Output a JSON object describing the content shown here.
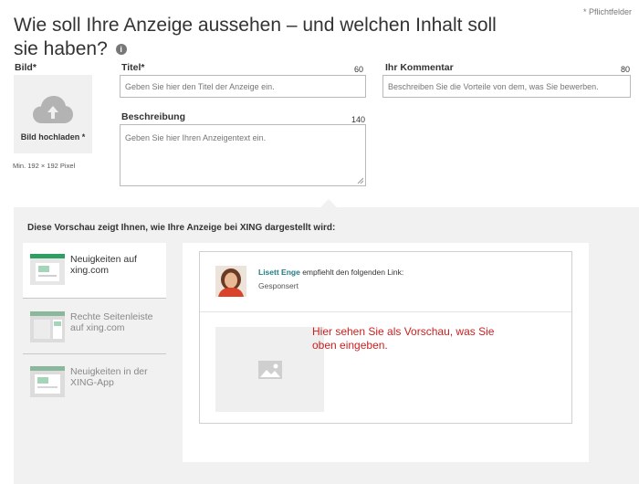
{
  "header": {
    "title": "Wie soll Ihre Anzeige aussehen – und welchen Inhalt soll sie haben?",
    "info_icon": "i",
    "required_note": "* Pflichtfelder"
  },
  "form": {
    "image": {
      "label": "Bild*",
      "upload_label": "Bild hochladen *",
      "hint": "Min. 192 × 192 Pixel",
      "icon": "cloud-upload-icon"
    },
    "title": {
      "label": "Titel*",
      "counter": "60",
      "placeholder": "Geben Sie hier den Titel der Anzeige ein."
    },
    "comment": {
      "label": "Ihr Kommentar",
      "counter": "80",
      "placeholder": "Beschreiben Sie die Vorteile von dem, was Sie bewerben."
    },
    "description": {
      "label": "Beschreibung",
      "counter": "140",
      "placeholder": "Geben Sie hier Ihren Anzeigentext ein."
    }
  },
  "preview": {
    "heading": "Diese Vorschau zeigt Ihnen, wie Ihre Anzeige bei XING dargestellt wird:",
    "nav": [
      {
        "label": "Neuigkeiten auf xing.com",
        "active": true
      },
      {
        "label": "Rechte Seitenleiste auf xing.com",
        "active": false
      },
      {
        "label": "Neuigkeiten in der XING-App",
        "active": false
      }
    ],
    "card": {
      "author": "Lisett Enge",
      "action": "empfiehlt den folgenden Link:",
      "sponsored": "Gesponsert",
      "note": "Hier sehen Sie als Vorschau, was Sie oben eingeben."
    }
  },
  "colors": {
    "accent_teal": "#1f7d86",
    "preview_note_red": "#cc1f1f",
    "thumb_green": "#2f9e63",
    "preview_bg": "#f1f1f1"
  }
}
